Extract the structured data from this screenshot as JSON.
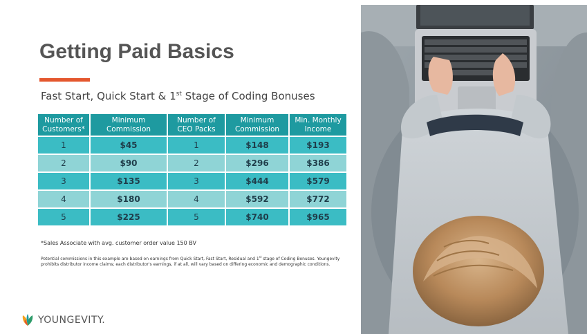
{
  "title": "Getting Paid Basics",
  "subtitle": {
    "main": "Fast Start, Quick Start & 1",
    "superscript": "st",
    "rest": " Stage of Coding Bonuses"
  },
  "colors": {
    "accent_bar": "#e4572e",
    "header_teal": "#1e9aa0",
    "row_dark": "#3bbcc4",
    "row_light": "#8fd4d6"
  },
  "table": {
    "headers": [
      "Number of Customers*",
      "Minimum Commission",
      "Number of CEO Packs",
      "Minimum Commission",
      "Min. Monthly Income"
    ],
    "rows": [
      [
        "1",
        "$45",
        "1",
        "$148",
        "$193"
      ],
      [
        "2",
        "$90",
        "2",
        "$296",
        "$386"
      ],
      [
        "3",
        "$135",
        "3",
        "$444",
        "$579"
      ],
      [
        "4",
        "$180",
        "4",
        "$592",
        "$772"
      ],
      [
        "5",
        "$225",
        "5",
        "$740",
        "$965"
      ]
    ]
  },
  "footnote": "*Sales Associate with avg. customer order value 150 BV",
  "disclaimer": {
    "before": "Potential commissions in this example are based on earnings from Quick Start, Fast Start, Residual and 1",
    "superscript": "st",
    "after": " stage of Coding Bonuses. Youngevity prohibits distributor income claims; each distributor's earnings, if at all, will vary based on differing economic and demographic conditions."
  },
  "logo": {
    "text": "YOUNGEVITY.",
    "icon": "youngevity-leaf-icon"
  },
  "photo": {
    "icon": "person-using-laptop-photo"
  }
}
